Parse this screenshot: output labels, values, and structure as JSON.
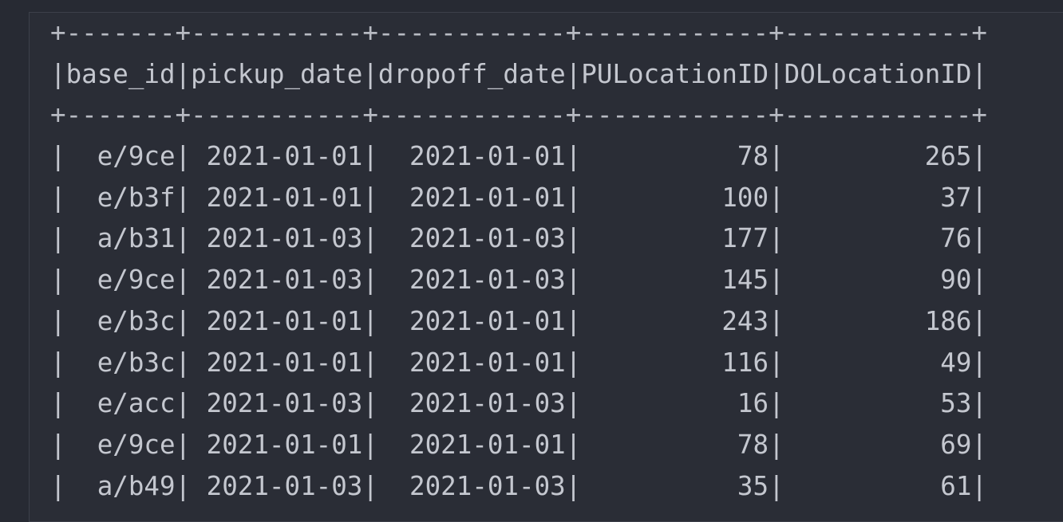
{
  "table": {
    "lines": [
      "+-------+-----------+------------+------------+------------+",
      "|base_id|pickup_date|dropoff_date|PULocationID|DOLocationID|",
      "+-------+-----------+------------+------------+------------+",
      "|  e/9ce| 2021-01-01|  2021-01-01|          78|         265|",
      "|  e/b3f| 2021-01-01|  2021-01-01|         100|          37|",
      "|  a/b31| 2021-01-03|  2021-01-03|         177|          76|",
      "|  e/9ce| 2021-01-03|  2021-01-03|         145|          90|",
      "|  e/b3c| 2021-01-01|  2021-01-01|         243|         186|",
      "|  e/b3c| 2021-01-01|  2021-01-01|         116|          49|",
      "|  e/acc| 2021-01-03|  2021-01-03|          16|          53|",
      "|  e/9ce| 2021-01-01|  2021-01-01|          78|          69|",
      "|  a/b49| 2021-01-03|  2021-01-03|          35|          61|"
    ]
  }
}
